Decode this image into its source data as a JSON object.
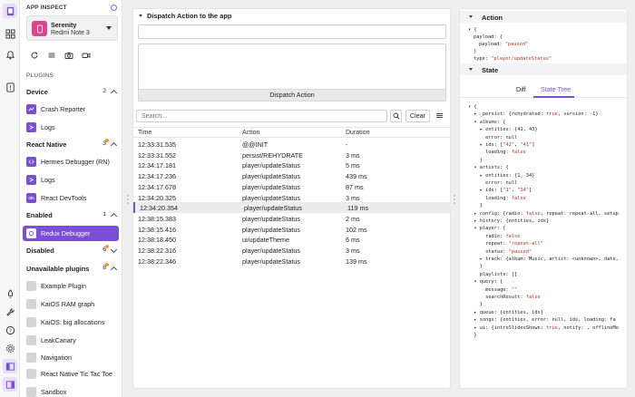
{
  "app": {
    "inspect_title": "APP INSPECT",
    "device_name": "Serenity",
    "device_model": "Redmi Note 3",
    "plugins_label": "PLUGINS"
  },
  "sidebar": {
    "sections": [
      {
        "name": "Device",
        "count": "2"
      },
      {
        "name": "React Native",
        "count": "3"
      },
      {
        "name": "Enabled",
        "count": "1"
      },
      {
        "name": "Disabled",
        "count": "6"
      },
      {
        "name": "Unavailable plugins",
        "count": "8"
      }
    ],
    "items": [
      {
        "label": "Crash Reporter",
        "icon": "crash-icon"
      },
      {
        "label": "Logs",
        "icon": "logs-icon"
      },
      {
        "label": "Hermes Debugger (RN)",
        "icon": "code-icon"
      },
      {
        "label": "Logs",
        "icon": "logs-icon"
      },
      {
        "label": "React DevTools",
        "icon": "react-icon"
      },
      {
        "label": "Redux Debugger",
        "icon": "redux-icon"
      },
      {
        "label": "Example Plugin",
        "icon": "plugin-icon"
      },
      {
        "label": "KaiOS RAM graph",
        "icon": "plugin-icon"
      },
      {
        "label": "KaiOS: big allocations",
        "icon": "plugin-icon"
      },
      {
        "label": "LeakCanary",
        "icon": "plugin-icon"
      },
      {
        "label": "Navigation",
        "icon": "plugin-icon"
      },
      {
        "label": "React Native Tic Tac Toe",
        "icon": "plugin-icon"
      },
      {
        "label": "Sandbox",
        "icon": "plugin-icon"
      }
    ]
  },
  "dispatch": {
    "title": "Dispatch Action to the app",
    "button_label": "Dispatch Action"
  },
  "search": {
    "placeholder": "Search...",
    "clear_label": "Clear"
  },
  "table": {
    "headers": [
      "Time",
      "Action",
      "Duration"
    ],
    "rows": [
      {
        "time": "12:33:31.535",
        "action": "@@INIT",
        "duration": "-"
      },
      {
        "time": "12:33:31.552",
        "action": "persist/REHYDRATE",
        "duration": "3 ms"
      },
      {
        "time": "12:34:17.181",
        "action": "player/updateStatus",
        "duration": "5 ms"
      },
      {
        "time": "12:34:17.236",
        "action": "player/updateStatus",
        "duration": "439 ms"
      },
      {
        "time": "12:34:17.678",
        "action": "player/updateStatus",
        "duration": "87 ms"
      },
      {
        "time": "12:34:20.325",
        "action": "player/updateStatus",
        "duration": "3 ms"
      },
      {
        "time": "12:34:20.354",
        "action": "player/updateStatus",
        "duration": "119 ms"
      },
      {
        "time": "12:38:15.383",
        "action": "player/updateStatus",
        "duration": "2 ms"
      },
      {
        "time": "12:38:15.416",
        "action": "player/updateStatus",
        "duration": "102 ms"
      },
      {
        "time": "12:38:18.450",
        "action": "ui/updateTheme",
        "duration": "6 ms"
      },
      {
        "time": "12:38:22.316",
        "action": "player/updateStatus",
        "duration": "3 ms"
      },
      {
        "time": "12:38:22.346",
        "action": "player/updateStatus",
        "duration": "139 ms"
      }
    ],
    "selected_index": 6
  },
  "action_panel": {
    "title": "Action",
    "lines": [
      {
        "indent": 0,
        "text": "▾ {"
      },
      {
        "indent": 1,
        "key": "payload",
        "open": "{"
      },
      {
        "indent": 2,
        "key": "payload",
        "string": "\"paused\""
      },
      {
        "indent": 1,
        "text": "}"
      },
      {
        "indent": 1,
        "key": "type",
        "string": "\"player/updateStatus\""
      }
    ]
  },
  "state_panel": {
    "title": "State",
    "tabs": [
      "Diff",
      "State Tree"
    ],
    "active_tab": "State Tree",
    "tree": [
      "▾ {",
      "  ▸ _persist: {rehydrated: true, version: -1}",
      "  ▾ albums: {",
      "    ▸ entities: {41, 43}",
      "      error: null",
      "    ▸ ids: [\"42\", \"41\"]",
      "      loading: false",
      "    }",
      "  ▾ artists: {",
      "    ▸ entities: {1, 34}",
      "      error: null",
      "    ▸ ids: [\"1\", \"34\"]",
      "      loading: false",
      "    }",
      "  ▸ config: {radio: false, repeat: repeat-all, setup",
      "  ▸ history: {entities, ids}",
      "  ▾ player: {",
      "      radio: false",
      "      repeat: \"repeat-all\"",
      "      status: \"paused\"",
      "    ▸ track: {album: Music, artist: <unknown>, date,",
      "    }",
      "    playlists: []",
      "  ▾ query: {",
      "      message: \"\"",
      "      searchResult: false",
      "    }",
      "  ▸ queue: {entities, ids}",
      "  ▸ songs: {entities, error: null, ids, loading: fa",
      "  ▸ ui: {introSlidesShown: true, notify: , offlineMo",
      "  }"
    ]
  },
  "colors": {
    "accent": "#7a4fd3",
    "device_icon": "#d9468b",
    "badge": "#f29b2b",
    "string": "#b5331f"
  }
}
